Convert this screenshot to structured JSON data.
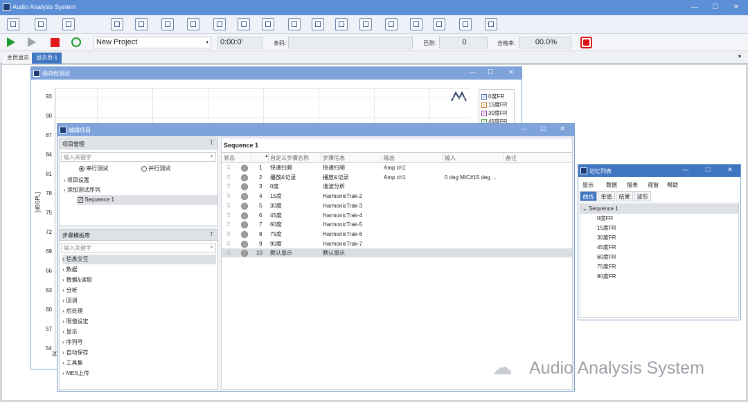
{
  "app": {
    "title": "Audio Analysis System"
  },
  "toolbar_icons": [
    "user-icon",
    "list-icon",
    "add-icon",
    "edit-icon",
    "save-icon",
    "camera-icon",
    "balance-icon",
    "keyboard-icon",
    "bluetooth-icon",
    "target-icon",
    "speaker-icon",
    "eye-icon",
    "sine-icon",
    "pulse-icon",
    "bars-icon",
    "meter-icon",
    "lock-icon",
    "chat-icon",
    "settings-icon"
  ],
  "runbar": {
    "project": "New Project",
    "timer": "0:00:0'",
    "barcode_label": "条码:",
    "tested_label": "已测:",
    "tested_value": "0",
    "pass_label": "合格率:",
    "pass_value": "00.0%"
  },
  "tabs": [
    "主页显示",
    "显示页-1"
  ],
  "chart_window": {
    "title": "指向性测试",
    "ylabel": "[dBSPL]",
    "y_ticks": [
      "93",
      "90",
      "87",
      "84",
      "81",
      "78",
      "75",
      "72",
      "69",
      "66",
      "63",
      "60",
      "57",
      "54"
    ],
    "x_first_tick": "20",
    "legend": [
      {
        "label": "0度FR",
        "color": "#3b6ea8"
      },
      {
        "label": "15度FR",
        "color": "#c7792d"
      },
      {
        "label": "30度FR",
        "color": "#8d3ea6"
      },
      {
        "label": "45度FR",
        "color": "#4c9a3c"
      }
    ]
  },
  "edit_window": {
    "title": "编辑项目",
    "project_panel": {
      "title": "项目管理",
      "pin": "⊤",
      "search_placeholder": "输入关键字",
      "modes": [
        "串行测试",
        "并行测试"
      ],
      "tree": [
        "项目设置",
        "添加测试序列",
        "Sequence 1"
      ]
    },
    "step_panel": {
      "title": "步骤模板库",
      "pin": "⊤",
      "search_placeholder": "输入关键字",
      "items": [
        "信息交互",
        "数据",
        "数据&读取",
        "分析",
        "回调",
        "后处理",
        "限值设定",
        "显示",
        "序列号",
        "自动保存",
        "工具集",
        "MES上传"
      ]
    },
    "sequence": {
      "title": "Sequence 1",
      "columns": [
        "状态",
        "",
        "自定义步骤名称",
        "步骤信息",
        "输出",
        "输入",
        "备注"
      ],
      "rows": [
        {
          "num": "1",
          "name": "快速扫频",
          "info": "快速扫频",
          "out": "Amp ch1",
          "in": ""
        },
        {
          "num": "2",
          "name": "播放&记录",
          "info": "播放&记录",
          "out": "Amp ch1",
          "in": "0 deg MIC#15 deg ..."
        },
        {
          "num": "3",
          "name": "0度",
          "info": "谐波分析",
          "out": "",
          "in": ""
        },
        {
          "num": "4",
          "name": "15度",
          "info": "HarmonicTrak-2",
          "out": "",
          "in": ""
        },
        {
          "num": "5",
          "name": "30度",
          "info": "HarmonicTrak-3",
          "out": "",
          "in": ""
        },
        {
          "num": "6",
          "name": "45度",
          "info": "HarmonicTrak-4",
          "out": "",
          "in": ""
        },
        {
          "num": "7",
          "name": "60度",
          "info": "HarmonicTrak-5",
          "out": "",
          "in": ""
        },
        {
          "num": "8",
          "name": "75度",
          "info": "HarmonicTrak-6",
          "out": "",
          "in": ""
        },
        {
          "num": "9",
          "name": "90度",
          "info": "HarmonicTrak-7",
          "out": "",
          "in": ""
        },
        {
          "num": "10",
          "name": "默认显示",
          "info": "默认显示",
          "out": "",
          "in": ""
        }
      ]
    }
  },
  "record_window": {
    "title": "记忆列表",
    "menu": [
      "显示",
      "数据",
      "报表",
      "视窗",
      "帮助"
    ],
    "tabs": [
      "曲线",
      "单值",
      "结果",
      "波形"
    ],
    "root": "Sequence 1",
    "items": [
      "0度FR",
      "15度FR",
      "30度FR",
      "45度FR",
      "60度FR",
      "75度FR",
      "90度FR"
    ]
  },
  "watermark": "Audio Analysis System"
}
